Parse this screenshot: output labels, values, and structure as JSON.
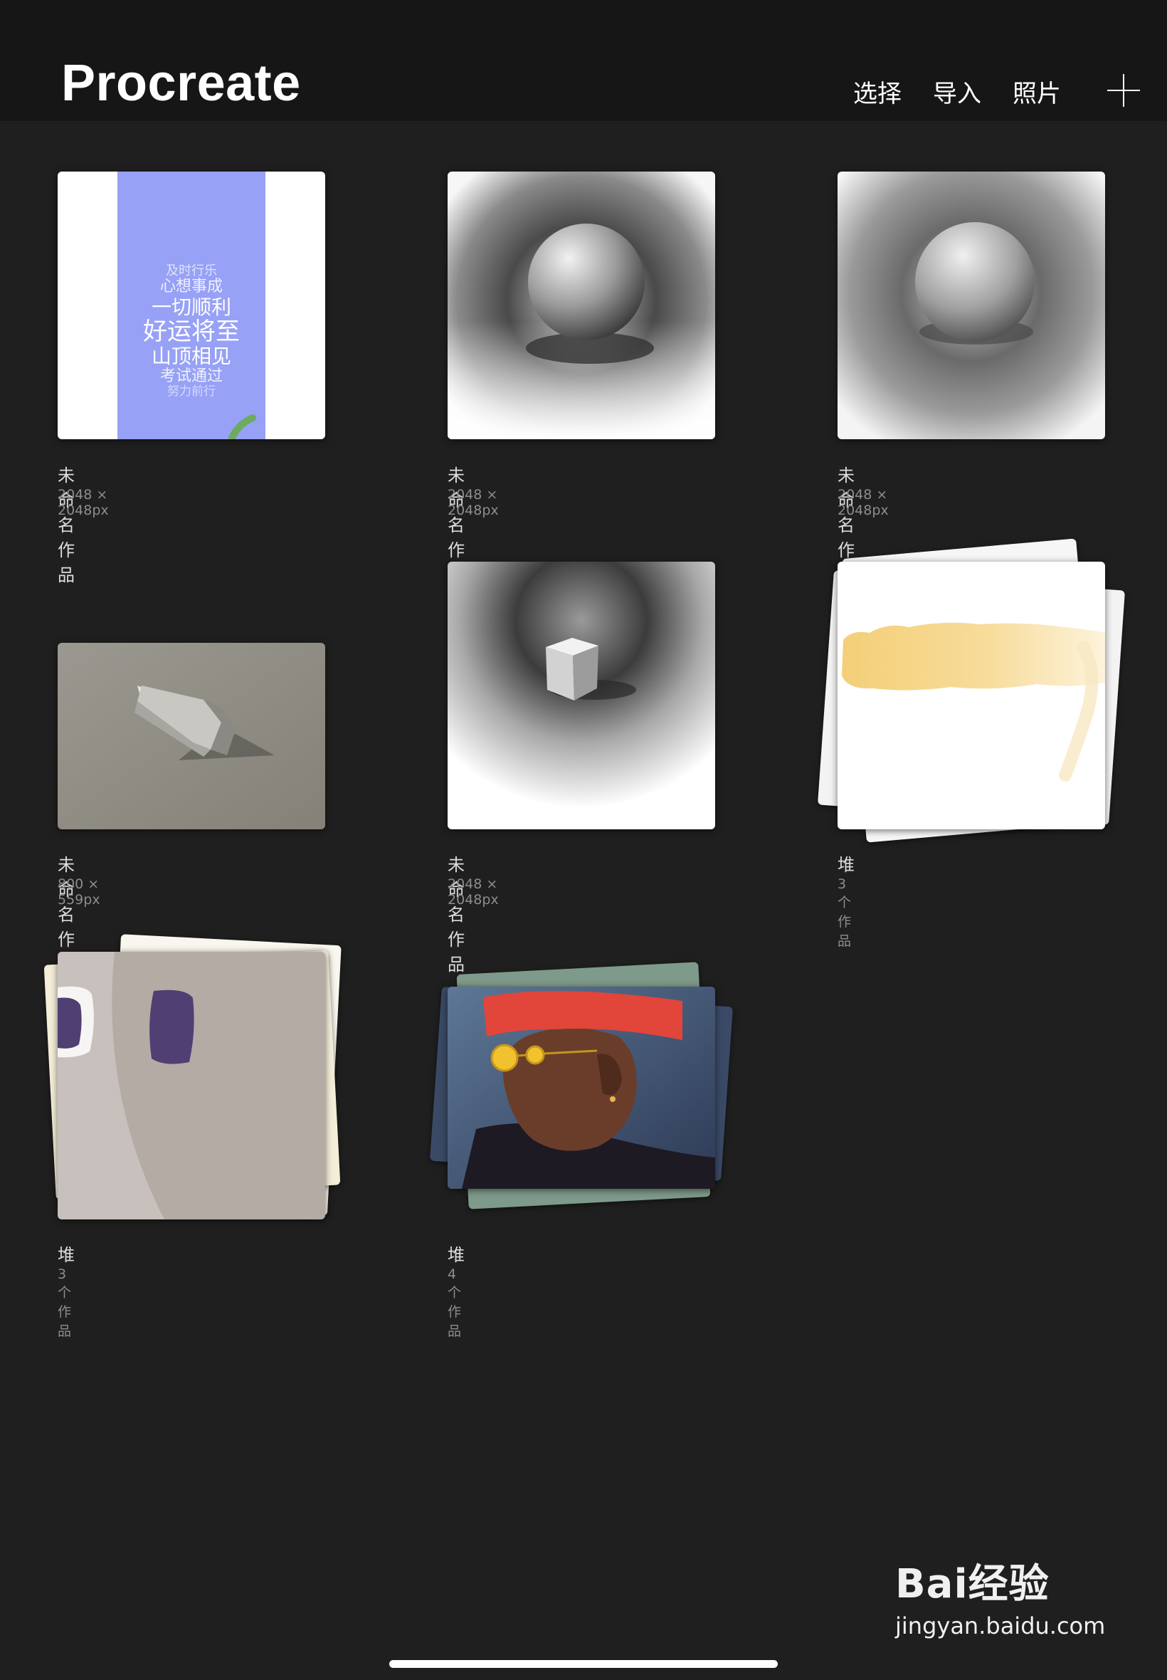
{
  "header": {
    "title": "Procreate",
    "select_label": "选择",
    "import_label": "导入",
    "photo_label": "照片",
    "add_icon": "plus-icon"
  },
  "artworks": [
    {
      "name": "未命名作品",
      "info": "2048 × 2048px"
    },
    {
      "name": "未命名作品",
      "info": "2048 × 2048px"
    },
    {
      "name": "未命名作品",
      "info": "2048 × 2048px"
    },
    {
      "name": "未命名作品",
      "info": "800 × 559px"
    },
    {
      "name": "未命名作品",
      "info": "2048 × 2048px"
    },
    {
      "name": "堆",
      "info": "3 个作品"
    },
    {
      "name": "堆",
      "info": "3 个作品"
    },
    {
      "name": "堆",
      "info": "4 个作品"
    }
  ],
  "poster": {
    "lines": [
      "及时行乐",
      "心想事成",
      "一切顺利",
      "好运将至",
      "山顶相见",
      "考试通过",
      "努力前行"
    ],
    "bg_color": "#97a1f6"
  },
  "watermark": {
    "brand": "Bai经验",
    "url": "jingyan.baidu.com"
  }
}
